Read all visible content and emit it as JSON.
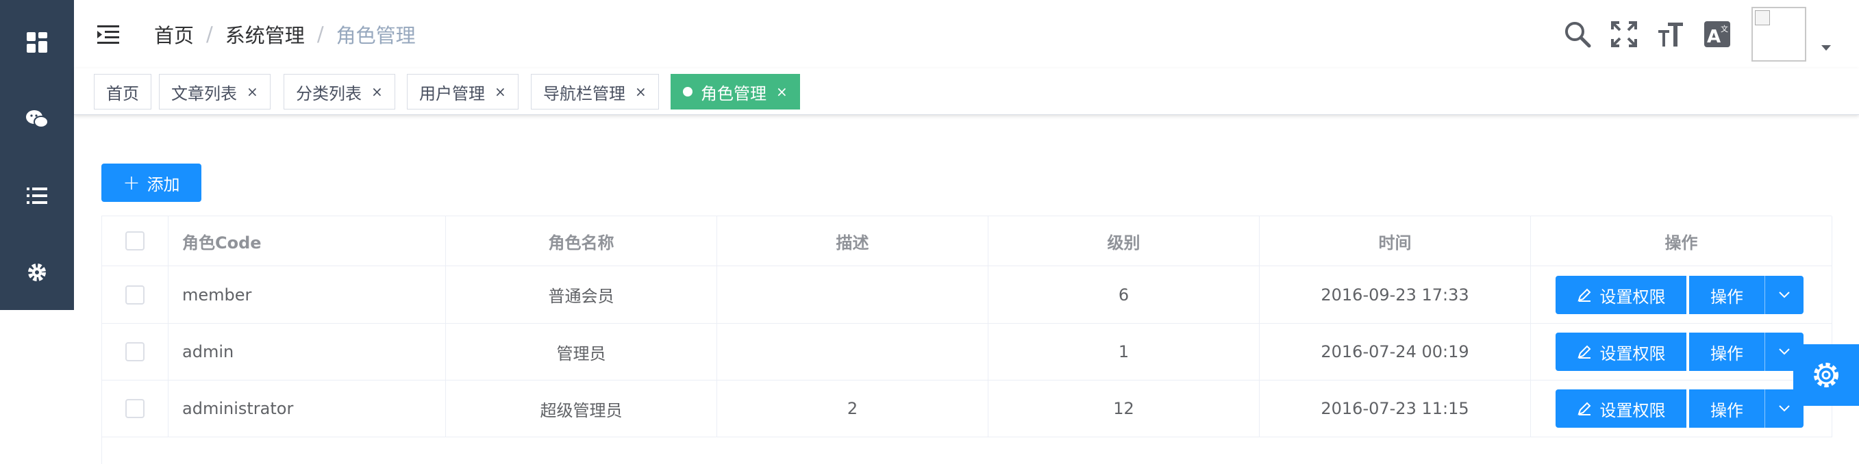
{
  "breadcrumb": [
    "首页",
    "系统管理",
    "角色管理"
  ],
  "breadcrumb_separator": "/",
  "tags": [
    {
      "label": "首页",
      "closable": false,
      "active": false
    },
    {
      "label": "文章列表",
      "closable": true,
      "active": false
    },
    {
      "label": "分类列表",
      "closable": true,
      "active": false
    },
    {
      "label": "用户管理",
      "closable": true,
      "active": false
    },
    {
      "label": "导航栏管理",
      "closable": true,
      "active": false
    },
    {
      "label": "角色管理",
      "closable": true,
      "active": true
    }
  ],
  "tag_close": "×",
  "toolbar": {
    "add_label": "添加",
    "add_icon": "+"
  },
  "table": {
    "columns": [
      "角色Code",
      "角色名称",
      "描述",
      "级别",
      "时间",
      "操作"
    ],
    "rows": [
      {
        "code": "member",
        "name": "普通会员",
        "desc": "",
        "level": "6",
        "time": "2016-09-23 17:33"
      },
      {
        "code": "admin",
        "name": "管理员",
        "desc": "",
        "level": "1",
        "time": "2016-07-24 00:19"
      },
      {
        "code": "administrator",
        "name": "超级管理员",
        "desc": "2",
        "level": "12",
        "time": "2016-07-23 11:15"
      }
    ],
    "actions": {
      "permission": "设置权限",
      "operate": "操作"
    }
  },
  "icons": {
    "sidebar": [
      "dashboard-icon",
      "wechat-icon",
      "list-icon",
      "settings-icon"
    ],
    "navbar": [
      "search-icon",
      "fullscreen-icon",
      "font-size-icon",
      "language-icon"
    ]
  },
  "colors": {
    "sidebar": "#304156",
    "primary": "#1890ff",
    "active_tag": "#42b983"
  }
}
